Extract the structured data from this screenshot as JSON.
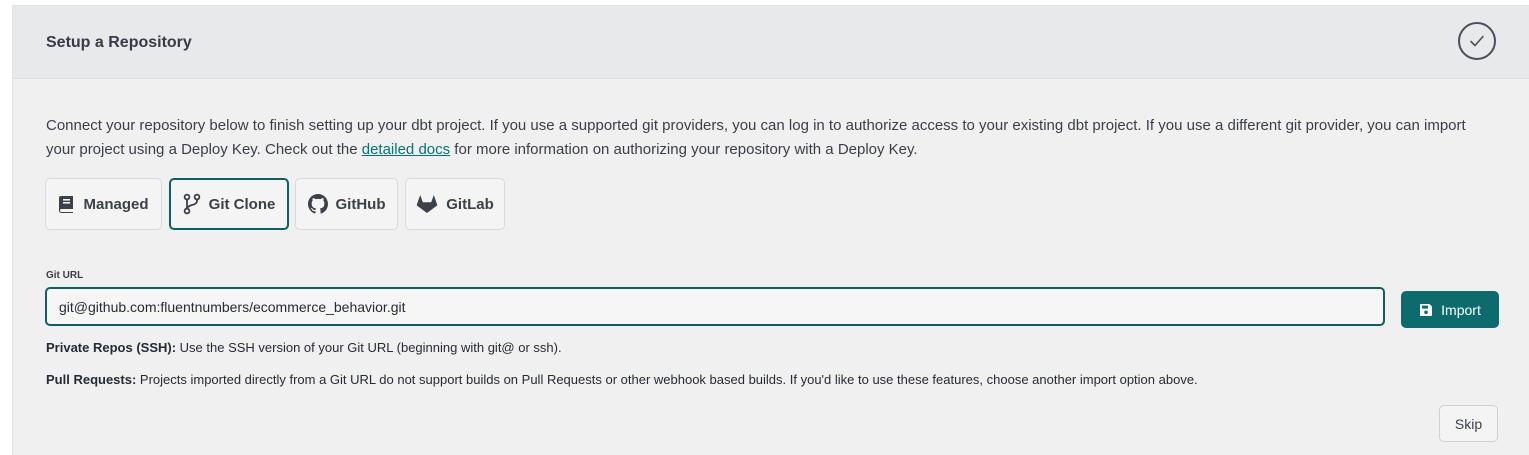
{
  "header": {
    "title": "Setup a Repository"
  },
  "intro": {
    "text_before": "Connect your repository below to finish setting up your dbt project. If you use a supported git providers, you can log in to authorize access to your existing dbt project. If you use a different git provider, you can import your project using a Deploy Key. Check out the ",
    "link_text": "detailed docs",
    "text_after": " for more information on authorizing your repository with a Deploy Key."
  },
  "tabs": [
    {
      "label": "Managed",
      "icon": "book-icon"
    },
    {
      "label": "Git Clone",
      "icon": "git-branch-icon",
      "active": true
    },
    {
      "label": "GitHub",
      "icon": "github-icon"
    },
    {
      "label": "GitLab",
      "icon": "gitlab-icon"
    }
  ],
  "git_url": {
    "label": "Git URL",
    "value": "git@github.com:fluentnumbers/ecommerce_behavior.git"
  },
  "import_button": {
    "label": "Import",
    "icon": "save-icon"
  },
  "notes": {
    "ssh_title": "Private Repos (SSH):",
    "ssh_text": " Use the SSH version of your Git URL (beginning with git@ or ssh).",
    "pr_title": "Pull Requests:",
    "pr_text": " Projects imported directly from a Git URL do not support builds on Pull Requests or other webhook based builds. If you'd like to use these features, choose another import option above."
  },
  "skip_button": {
    "label": "Skip"
  },
  "colors": {
    "accent": "#0d6b6e",
    "link": "#047377"
  }
}
